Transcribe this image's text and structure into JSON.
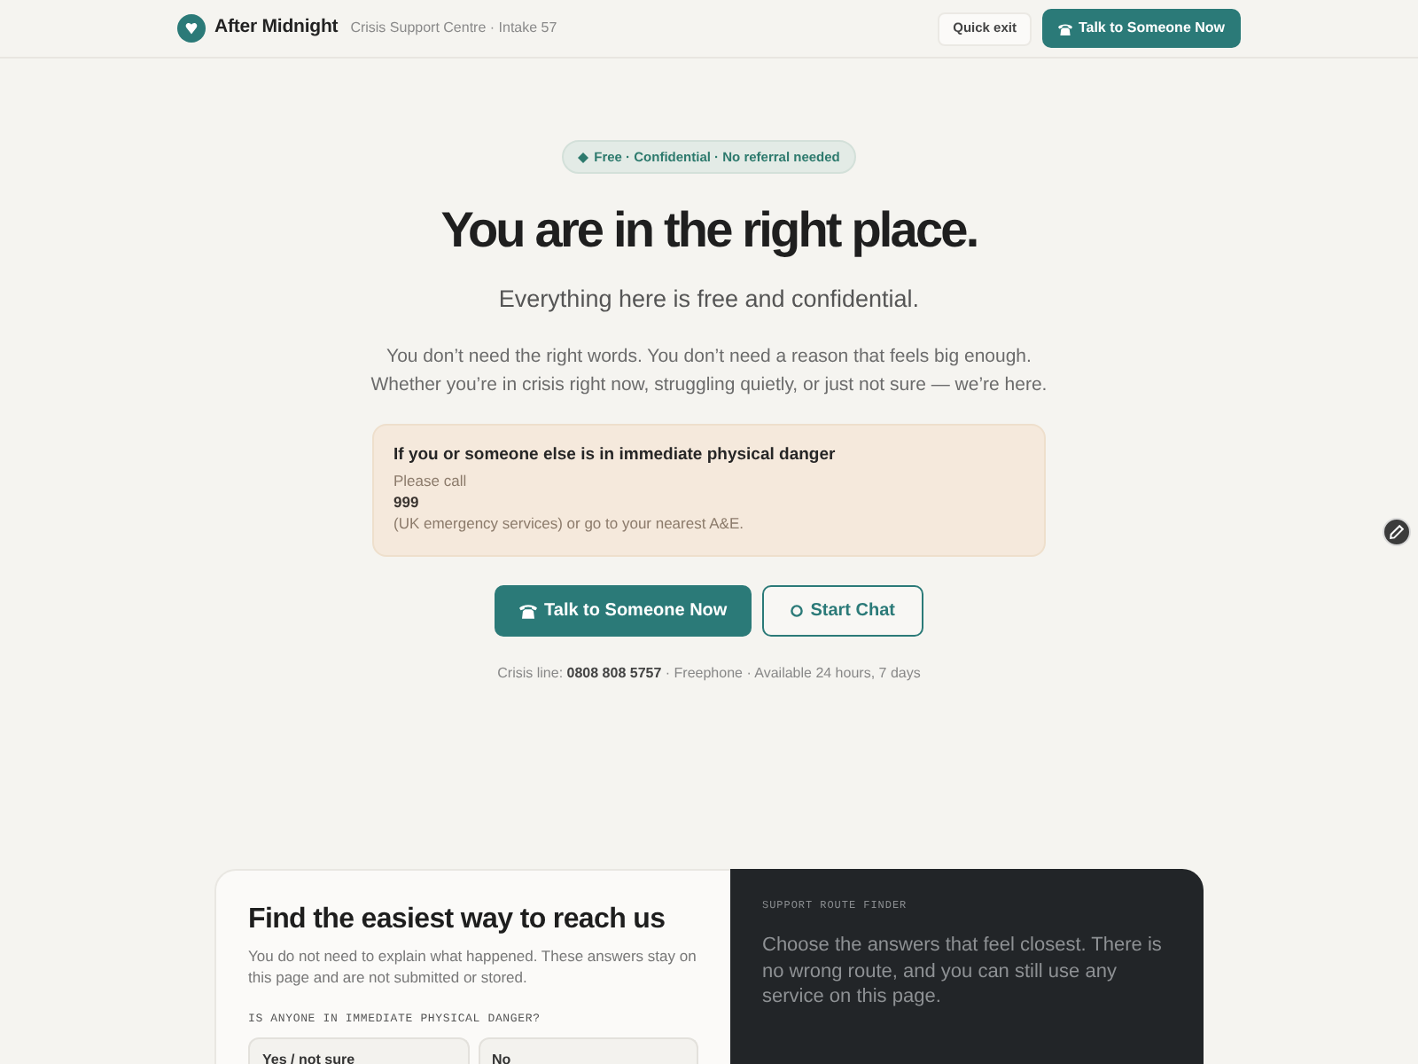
{
  "header": {
    "brand": "After Midnight",
    "subtitle": "Crisis Support Centre · Intake 57",
    "quick_exit": "Quick exit",
    "call_button": "Talk to Someone Now"
  },
  "hero": {
    "badge": "Free · Confidential · No referral needed",
    "title": "You are in the right place.",
    "subtitle": "Everything here is free and confidential.",
    "intro": "You don’t need the right words. You don’t need a reason that feels big enough. Whether you’re in crisis right now, struggling quietly, or just not sure — we’re here.",
    "danger_notice": {
      "title": "If you or someone else is in immediate physical danger",
      "lines": [
        {
          "kind": "plain",
          "text": "Please call"
        },
        {
          "kind": "strong",
          "text": "999"
        },
        {
          "kind": "plain",
          "text": "(UK emergency services) or go to your nearest A&E."
        }
      ]
    },
    "actions": [
      {
        "kind": "primary",
        "label": "Talk to Someone Now"
      },
      {
        "kind": "secondary",
        "label": "Start Chat"
      }
    ],
    "crisis_line": "Crisis line: **0808 808 5757** · Freephone · Available 24 hours, 7 days"
  },
  "route_finder": {
    "title": "Find the easiest way to reach us",
    "description": "You do not need to explain what happened. These answers stay on this page and are not submitted or stored.",
    "question": "IS ANYONE IN IMMEDIATE PHYSICAL DANGER?",
    "options": [
      {
        "label": "Yes / not sure",
        "selected": false
      },
      {
        "label": "No",
        "selected": false
      }
    ],
    "panel_label": "SUPPORT ROUTE FINDER",
    "panel_text": "Choose the answers that feel closest. There is no wrong route, and you can still use any service on this page."
  }
}
